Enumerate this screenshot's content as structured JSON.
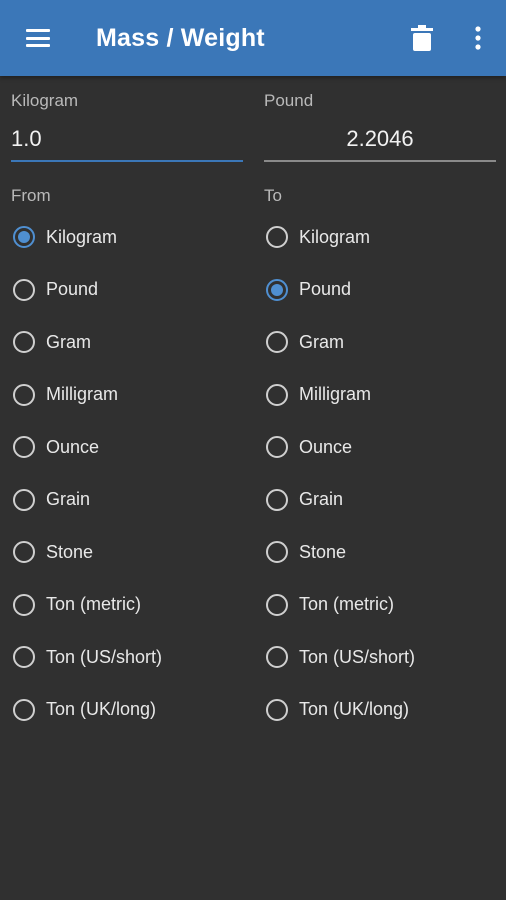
{
  "app_bar": {
    "title": "Mass / Weight",
    "background_color": "#3b77b8",
    "icons": [
      "menu-icon",
      "trash-icon",
      "more-vert-icon"
    ]
  },
  "input_left": {
    "label": "Kilogram",
    "value": "1.0"
  },
  "input_right": {
    "label": "Pound",
    "value": "2.2046"
  },
  "from": {
    "heading": "From",
    "selected": "Kilogram",
    "options": [
      "Kilogram",
      "Pound",
      "Gram",
      "Milligram",
      "Ounce",
      "Grain",
      "Stone",
      "Ton (metric)",
      "Ton (US/short)",
      "Ton (UK/long)"
    ]
  },
  "to": {
    "heading": "To",
    "selected": "Pound",
    "options": [
      "Kilogram",
      "Pound",
      "Gram",
      "Milligram",
      "Ounce",
      "Grain",
      "Stone",
      "Ton (metric)",
      "Ton (US/short)",
      "Ton (UK/long)"
    ]
  },
  "colors": {
    "background": "#303030",
    "accent": "#4f8fd1"
  }
}
